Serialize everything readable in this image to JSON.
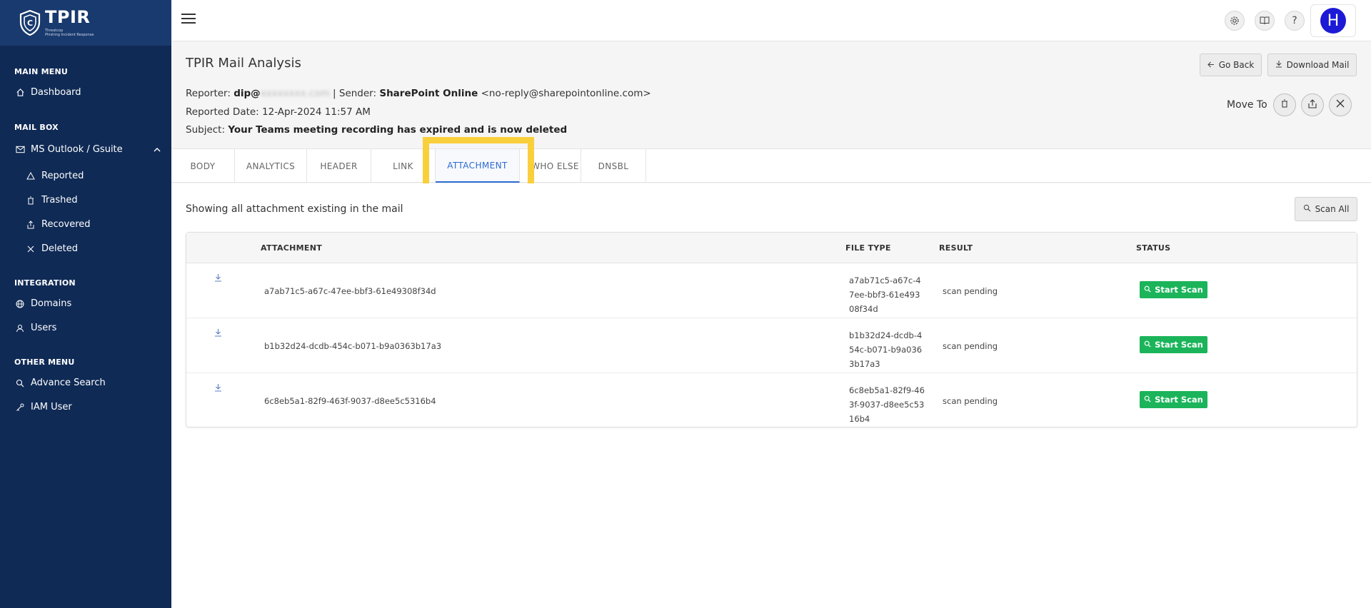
{
  "brand": {
    "title": "TPIR",
    "subtitle_line1": "Threatcop",
    "subtitle_line2": "Phishing Incident Response"
  },
  "sidebar": {
    "sections": [
      {
        "label": "MAIN MENU"
      },
      {
        "label": "MAIL BOX"
      },
      {
        "label": "INTEGRATION"
      },
      {
        "label": "OTHER MENU"
      }
    ],
    "items": [
      {
        "label": "Dashboard",
        "icon": "home-icon"
      },
      {
        "label": "MS Outlook / Gsuite",
        "icon": "mail-icon"
      },
      {
        "label": "Reported",
        "icon": "warning-icon"
      },
      {
        "label": "Trashed",
        "icon": "trash-icon"
      },
      {
        "label": "Recovered",
        "icon": "recover-icon"
      },
      {
        "label": "Deleted",
        "icon": "close-icon"
      },
      {
        "label": "Domains",
        "icon": "globe-icon"
      },
      {
        "label": "Users",
        "icon": "user-icon"
      },
      {
        "label": "Advance Search",
        "icon": "search-icon"
      },
      {
        "label": "IAM User",
        "icon": "key-icon"
      }
    ]
  },
  "topbar": {
    "avatar_initial": "H"
  },
  "mail": {
    "title": "TPIR Mail Analysis",
    "reporter_label": "Reporter:",
    "reporter_name": "dip@",
    "reporter_domain_redacted": "xxxxxxxx.com",
    "sender_label": "| Sender:",
    "sender_name": "SharePoint Online",
    "sender_email": "<no-reply@sharepointonline.com>",
    "reported_date_label": "Reported Date:",
    "reported_date": "12-Apr-2024 11:57 AM",
    "subject_label": "Subject:",
    "subject": "Your Teams meeting recording has expired and is now deleted"
  },
  "actions": {
    "go_back": "Go Back",
    "download_mail": "Download Mail",
    "move_to": "Move To"
  },
  "tabs": [
    {
      "label": "BODY"
    },
    {
      "label": "ANALYTICS"
    },
    {
      "label": "HEADER"
    },
    {
      "label": "LINK"
    },
    {
      "label": "ATTACHMENT"
    },
    {
      "label": "WHO ELSE"
    },
    {
      "label": "DNSBL"
    }
  ],
  "active_tab": "ATTACHMENT",
  "attachments": {
    "showing_text": "Showing all attachment existing in the mail",
    "scan_all": "Scan All",
    "columns": {
      "attachment": "ATTACHMENT",
      "file_type": "FILE TYPE",
      "result": "RESULT",
      "status": "STATUS"
    },
    "rows": [
      {
        "name": "a7ab71c5-a67c-47ee-bbf3-61e49308f34d",
        "file_type": "a7ab71c5-a67c-47ee-bbf3-61e49308f34d",
        "result": "scan pending",
        "action": "Start Scan"
      },
      {
        "name": "b1b32d24-dcdb-454c-b071-b9a0363b17a3",
        "file_type": "b1b32d24-dcdb-454c-b071-b9a0363b17a3",
        "result": "scan pending",
        "action": "Start Scan"
      },
      {
        "name": "6c8eb5a1-82f9-463f-9037-d8ee5c5316b4",
        "file_type": "6c8eb5a1-82f9-463f-9037-d8ee5c5316b4",
        "result": "scan pending",
        "action": "Start Scan"
      }
    ]
  },
  "colors": {
    "sidebar_bg": "#0f2a55",
    "active_tab": "#2e6bd1",
    "start_scan": "#1bb45a",
    "highlight": "#f9cf3b",
    "avatar": "#1d1ad6"
  }
}
